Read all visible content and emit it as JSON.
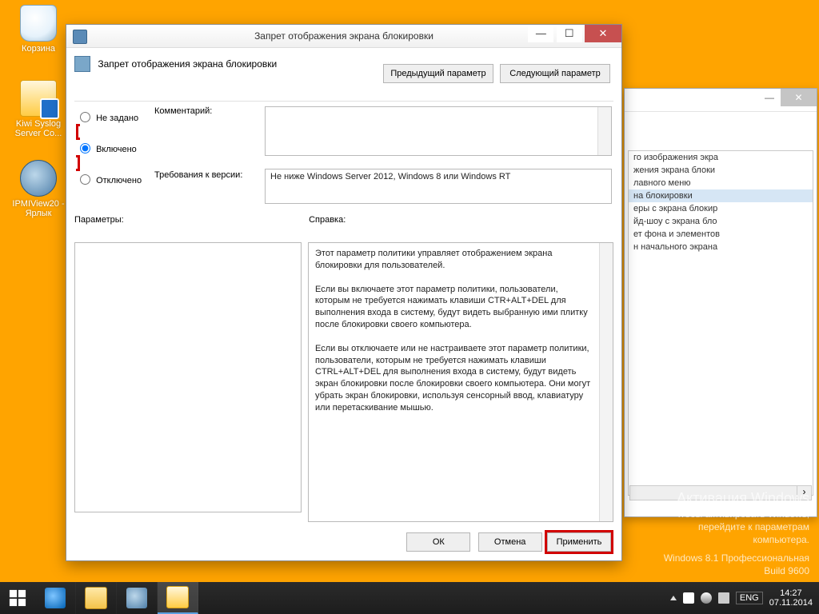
{
  "desktop": {
    "icons": [
      {
        "label": "Корзина"
      },
      {
        "label": "Kiwi Syslog Server Co..."
      },
      {
        "label": "IPMIView20 - Ярлык"
      }
    ]
  },
  "bg_window": {
    "items": [
      "го изображения экра",
      "жения экрана блоки",
      "лавного меню",
      "на блокировки",
      "еры с экрана блокир",
      "йд-шоу с экрана бло",
      "ет фона и элементов",
      "н начального экрана"
    ],
    "selected_index": 3
  },
  "policy_window": {
    "title": "Запрет отображения экрана блокировки",
    "header": "Запрет отображения экрана блокировки",
    "prev_btn": "Предыдущий параметр",
    "next_btn": "Следующий параметр",
    "radio_notconfig": "Не задано",
    "radio_enabled": "Включено",
    "radio_disabled": "Отключено",
    "comment_label": "Комментарий:",
    "requirements_label": "Требования к версии:",
    "requirements_text": "Не ниже Windows Server 2012, Windows 8 или Windows RT",
    "params_label": "Параметры:",
    "help_label": "Справка:",
    "help_text_p1": "Этот параметр политики управляет отображением экрана блокировки для пользователей.",
    "help_text_p2": "Если вы включаете этот параметр политики, пользователи, которым не требуется нажимать клавиши CTR+ALT+DEL для выполнения входа в систему, будут видеть выбранную ими плитку после блокировки своего компьютера.",
    "help_text_p3": "Если вы отключаете или не настраиваете этот параметр политики, пользователи, которым не требуется нажимать клавиши CTRL+ALT+DEL для выполнения входа в систему, будут видеть экран блокировки после блокировки своего компьютера. Они могут убрать экран блокировки, используя сенсорный ввод, клавиатуру или перетаскивание мышью.",
    "ok_btn": "ОК",
    "cancel_btn": "Отмена",
    "apply_btn": "Применить"
  },
  "watermark": {
    "title": "Активация Windows",
    "line1": "Чтобы активировать Windows,",
    "line2": "перейдите к параметрам",
    "line3": "компьютера.",
    "build1": "Windows 8.1 Профессиональная",
    "build2": "Build 9600"
  },
  "taskbar": {
    "lang": "ENG",
    "time": "14:27",
    "date": "07.11.2014"
  }
}
